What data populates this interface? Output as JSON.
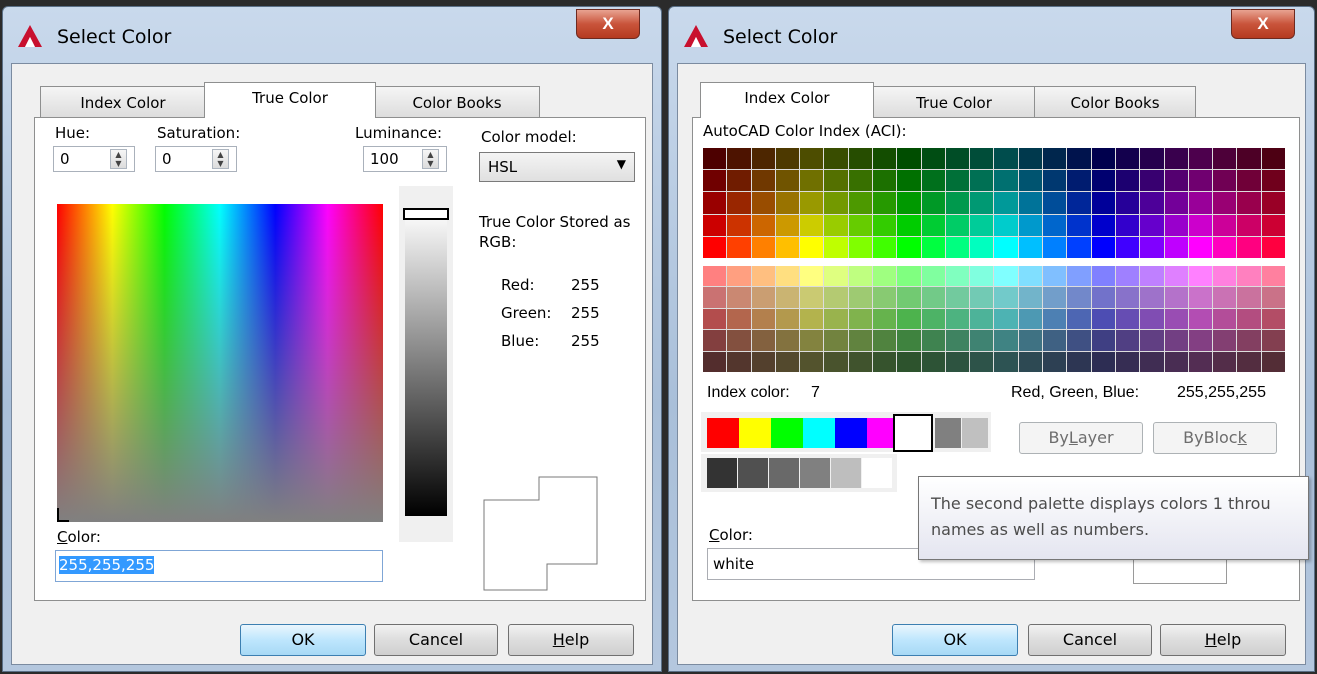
{
  "left_dialog": {
    "title": "Select Color",
    "close": "X",
    "tabs": [
      "Index Color",
      "True Color",
      "Color Books"
    ],
    "selected_tab": "True Color",
    "hue": {
      "label": "Hue:",
      "value": "0"
    },
    "saturation": {
      "label": "Saturation:",
      "value": "0"
    },
    "luminance": {
      "label": "Luminance:",
      "value": "100"
    },
    "color_model": {
      "label": "Color model:",
      "value": "HSL"
    },
    "stored_label": "True Color Stored as RGB:",
    "rgb": [
      {
        "label": "Red:",
        "value": "255"
      },
      {
        "label": "Green:",
        "value": "255"
      },
      {
        "label": "Blue:",
        "value": "255"
      }
    ],
    "color_label": "Color:",
    "color_value": "255,255,255",
    "buttons": {
      "ok": "OK",
      "cancel": "Cancel",
      "help": "Help"
    }
  },
  "right_dialog": {
    "title": "Select Color",
    "close": "X",
    "tabs": [
      "Index Color",
      "True Color",
      "Color Books"
    ],
    "selected_tab": "Index Color",
    "aci_label": "AutoCAD Color Index (ACI):",
    "index_color_label": "Index color:",
    "index_color_value": "7",
    "rgb_label": "Red, Green, Blue:",
    "rgb_value": "255,255,255",
    "bylayer": "ByLayer",
    "byblock": "ByBlock",
    "tooltip": {
      "line1": "The second palette displays colors 1 throu",
      "line2": "names as well as numbers."
    },
    "color_label": "Color:",
    "color_value": "white",
    "buttons": {
      "ok": "OK",
      "cancel": "Cancel",
      "help": "Help"
    },
    "standard_colors": [
      "#ff0000",
      "#ffff00",
      "#00ff00",
      "#00ffff",
      "#0000ff",
      "#ff00ff",
      "#ffffff",
      "#808080",
      "#c0c0c0"
    ],
    "gray_colors": [
      "#333333",
      "#505050",
      "#696969",
      "#808080",
      "#bebebe",
      "#ffffff"
    ]
  }
}
